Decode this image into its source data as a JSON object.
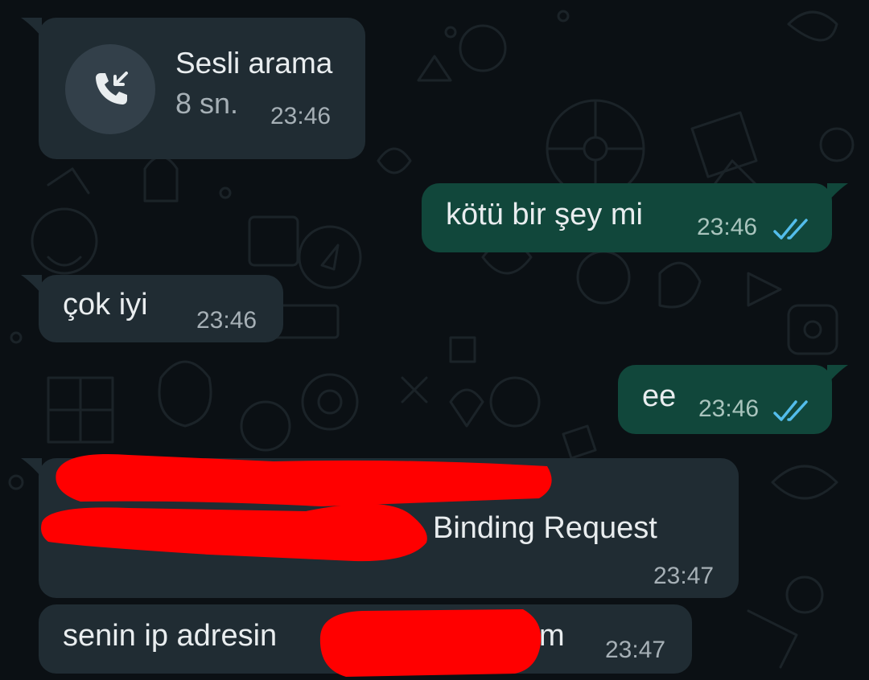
{
  "colors": {
    "background": "#0b1014",
    "incoming_bubble": "#202c33",
    "outgoing_bubble": "#11473b",
    "read_ticks": "#53bdeb",
    "redaction": "#ff0000"
  },
  "messages": [
    {
      "direction": "incoming",
      "type": "voice-call",
      "title": "Sesli arama",
      "duration": "8 sn.",
      "time": "23:46",
      "icon": "incoming-call-icon"
    },
    {
      "direction": "outgoing",
      "text": "kötü bir şey mi",
      "time": "23:46",
      "status": "read",
      "status_icon": "double-check-icon"
    },
    {
      "direction": "incoming",
      "text": "çok iyi",
      "time": "23:46"
    },
    {
      "direction": "outgoing",
      "text": "ee",
      "time": "23:46",
      "status": "read",
      "status_icon": "double-check-icon"
    },
    {
      "direction": "incoming",
      "text_visible": "Binding Request",
      "redacted": true,
      "time": "23:47"
    },
    {
      "direction": "incoming",
      "text_visible_start": "senin ip adresin",
      "text_visible_end": "m",
      "redacted": true,
      "time": "23:47"
    }
  ]
}
